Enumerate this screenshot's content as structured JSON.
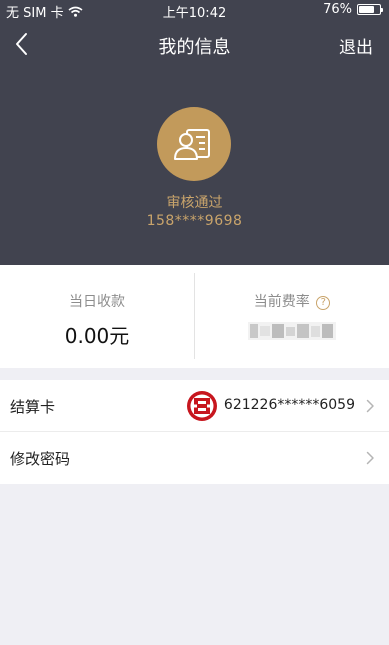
{
  "statusbar": {
    "carrier": "无 SIM 卡",
    "time": "上午10:42",
    "battery": "76%",
    "battery_level": 0.76
  },
  "nav": {
    "title": "我的信息",
    "logout_label": "退出"
  },
  "profile": {
    "status": "审核通过",
    "phone": "158****9698"
  },
  "stats": {
    "today_label": "当日收款",
    "today_value": "0.00元",
    "rate_label": "当前费率"
  },
  "list": {
    "card_label": "结算卡",
    "card_number": "621226******6059",
    "password_label": "修改密码"
  },
  "colors": {
    "header_bg": "#41434f",
    "accent_gold": "#c29a5b",
    "bank_red": "#c7161e"
  },
  "icons": {
    "back": "chevron-left-icon",
    "avatar": "profile-card-icon",
    "help": "question-circle-icon",
    "bank": "icbc-logo",
    "chevron": "chevron-right-icon",
    "wifi": "wifi-icon",
    "battery": "battery-icon"
  }
}
